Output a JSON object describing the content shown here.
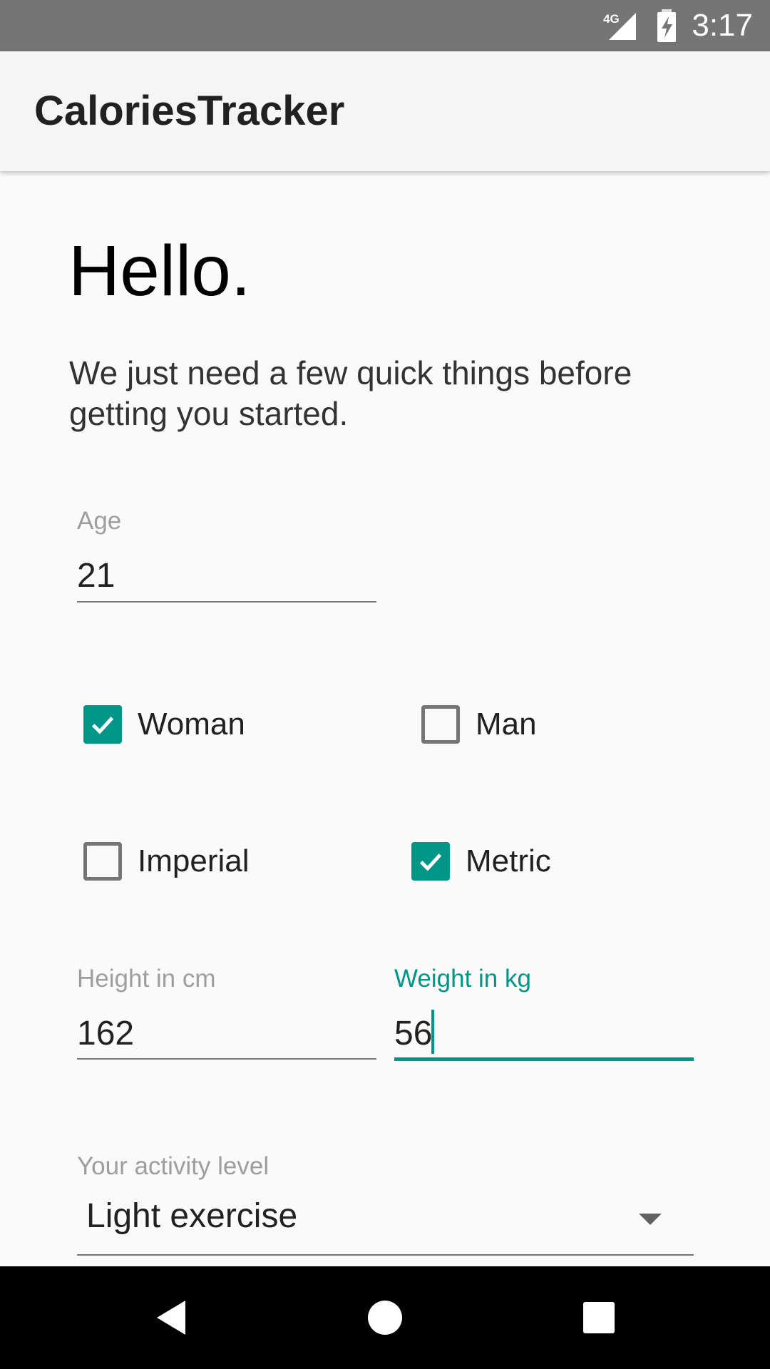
{
  "status_bar": {
    "network": "4G",
    "time": "3:17"
  },
  "app_bar": {
    "title": "CaloriesTracker"
  },
  "main": {
    "greeting": "Hello.",
    "intro": "We just need a few quick things before getting you started.",
    "age": {
      "label": "Age",
      "value": "21"
    },
    "gender": {
      "woman": {
        "label": "Woman",
        "checked": true
      },
      "man": {
        "label": "Man",
        "checked": false
      }
    },
    "units": {
      "imperial": {
        "label": "Imperial",
        "checked": false
      },
      "metric": {
        "label": "Metric",
        "checked": true
      }
    },
    "height": {
      "label": "Height in cm",
      "value": "162"
    },
    "weight": {
      "label": "Weight in kg",
      "value": "56",
      "focused": true
    },
    "activity": {
      "label": "Your activity level",
      "selected": "Light exercise"
    }
  },
  "nav_bar": {
    "icons": [
      "back-icon",
      "home-icon",
      "recents-icon"
    ]
  },
  "colors": {
    "accent": "#009688",
    "status_bar": "#757575",
    "app_bar": "#f5f5f5",
    "background": "#fafafa",
    "nav_bar": "#000000"
  }
}
